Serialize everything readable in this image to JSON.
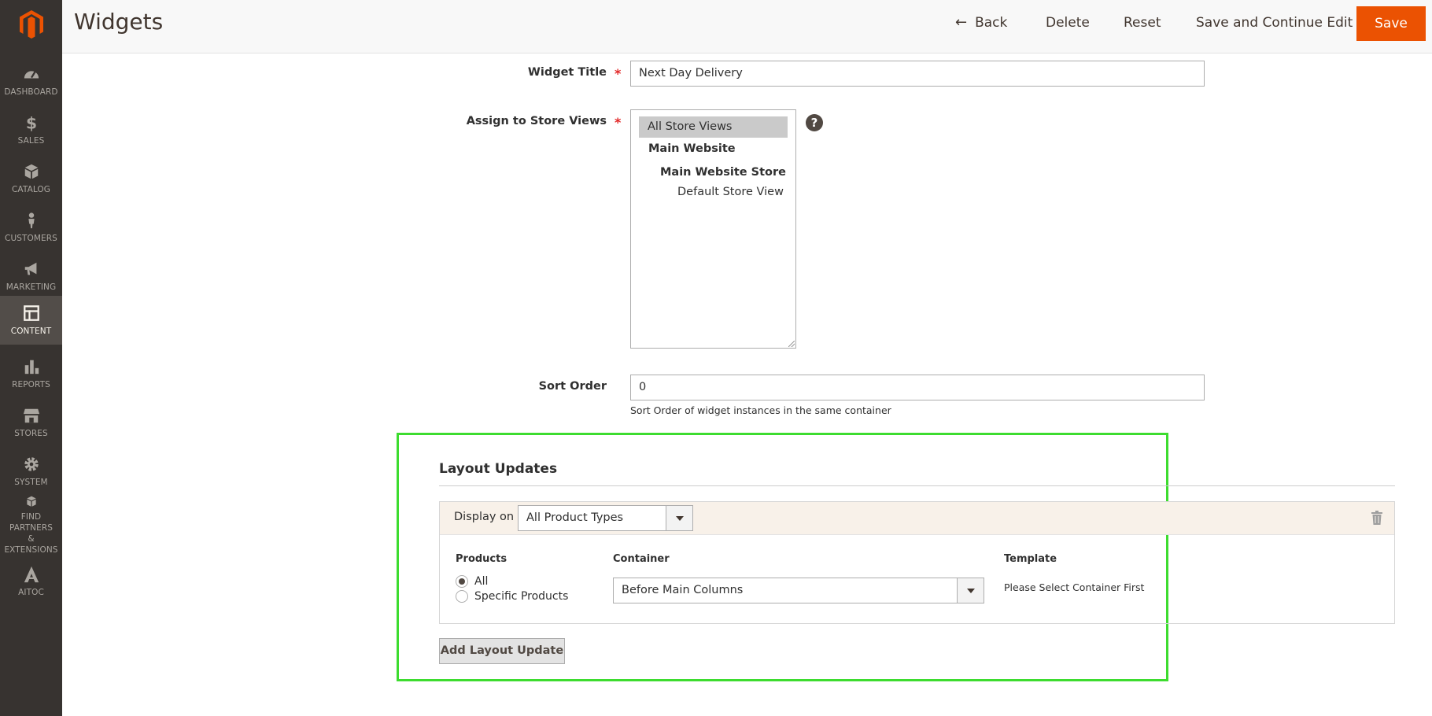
{
  "colors": {
    "sidebar_bg": "#373330",
    "accent": "#eb5202",
    "highlight": "#3ddc2f"
  },
  "sidebar": {
    "items": [
      {
        "label": "DASHBOARD",
        "icon": "dashboard-icon"
      },
      {
        "label": "SALES",
        "icon": "dollar-icon"
      },
      {
        "label": "CATALOG",
        "icon": "box-icon"
      },
      {
        "label": "CUSTOMERS",
        "icon": "person-icon"
      },
      {
        "label": "MARKETING",
        "icon": "megaphone-icon"
      },
      {
        "label": "CONTENT",
        "icon": "layout-icon",
        "active": true
      },
      {
        "label": "REPORTS",
        "icon": "bar-chart-icon"
      },
      {
        "label": "STORES",
        "icon": "storefront-icon"
      },
      {
        "label": "SYSTEM",
        "icon": "gear-icon"
      },
      {
        "label": "FIND PARTNERS\n& EXTENSIONS",
        "icon": "cubes-icon"
      },
      {
        "label": "AITOC",
        "icon": "aitoc-icon"
      }
    ]
  },
  "header": {
    "title": "Widgets",
    "back_label": "Back",
    "delete_label": "Delete",
    "reset_label": "Reset",
    "save_continue_label": "Save and Continue Edit",
    "save_label": "Save"
  },
  "form": {
    "widget_title": {
      "label": "Widget Title",
      "value": "Next Day Delivery"
    },
    "store_views": {
      "label": "Assign to Store Views",
      "options": [
        "All Store Views",
        "Main Website",
        "Main Website Store",
        "Default Store View"
      ],
      "selected": "All Store Views"
    },
    "sort_order": {
      "label": "Sort Order",
      "value": "0",
      "note": "Sort Order of widget instances in the same container"
    }
  },
  "layout_updates": {
    "title": "Layout Updates",
    "display_on_label": "Display on",
    "display_on_value": "All Product Types",
    "products_header": "Products",
    "products_options": [
      "All",
      "Specific Products"
    ],
    "products_selected": "All",
    "container_header": "Container",
    "container_value": "Before Main Columns",
    "template_header": "Template",
    "template_note": "Please Select Container First",
    "add_button": "Add Layout Update"
  }
}
